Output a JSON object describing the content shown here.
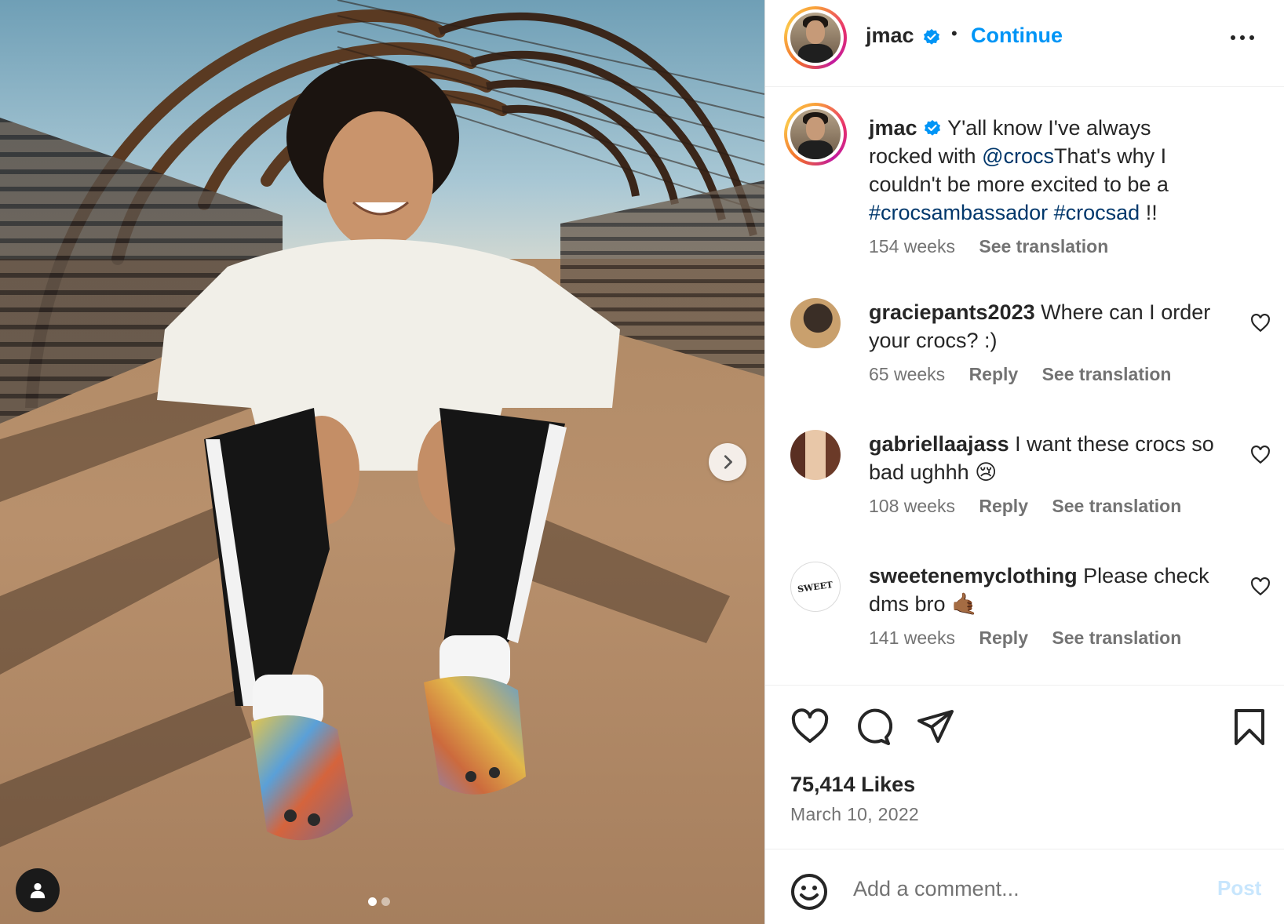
{
  "post": {
    "image_alt": "Young man in white hoodie sitting on a wooden bridge wearing colorful tie-dye Crocs",
    "carousel": {
      "total": 2,
      "active": 1
    }
  },
  "header": {
    "username": "jmac",
    "separator": "•",
    "continue_label": "Continue"
  },
  "caption": {
    "username": "jmac",
    "text_1": " Y'all know I've always rocked with ",
    "mention": "@crocs",
    "text_2": "That's why I couldn't be more excited to be a ",
    "hashtag_1": "#crocsambassador",
    "hashtag_2": "#crocsad",
    "text_3": " !!",
    "time": "154 weeks",
    "translate": "See translation"
  },
  "comments": [
    {
      "username": "graciepants2023",
      "text": " Where can I order your crocs? :)",
      "time": "65 weeks",
      "reply": "Reply",
      "translate": "See translation"
    },
    {
      "username": "gabriellaajass",
      "text": " I want these crocs so bad ughhh 😢",
      "time": "108 weeks",
      "reply": "Reply",
      "translate": "See translation"
    },
    {
      "username": "sweetenemyclothing",
      "text": " Please check dms bro 🤙🏾",
      "time": "141 weeks",
      "reply": "Reply",
      "translate": "See translation",
      "avatar_text": "SWEET"
    }
  ],
  "stats": {
    "likes": "75,414 Likes",
    "date": "March 10, 2022"
  },
  "composer": {
    "placeholder": "Add a comment...",
    "post_label": "Post"
  },
  "icons": {
    "verified": "verified-badge-icon",
    "more": "more-horizontal-icon",
    "heart": "heart-icon",
    "comment": "comment-bubble-icon",
    "share": "paper-plane-icon",
    "save": "bookmark-icon",
    "emoji": "emoji-smiley-icon",
    "next": "chevron-right-icon",
    "tag": "user-tag-icon"
  },
  "colors": {
    "link_blue": "#0095f6",
    "mention_blue": "#00376b",
    "text": "#262626",
    "secondary": "#737373",
    "post_disabled": "#c8e6fd"
  }
}
